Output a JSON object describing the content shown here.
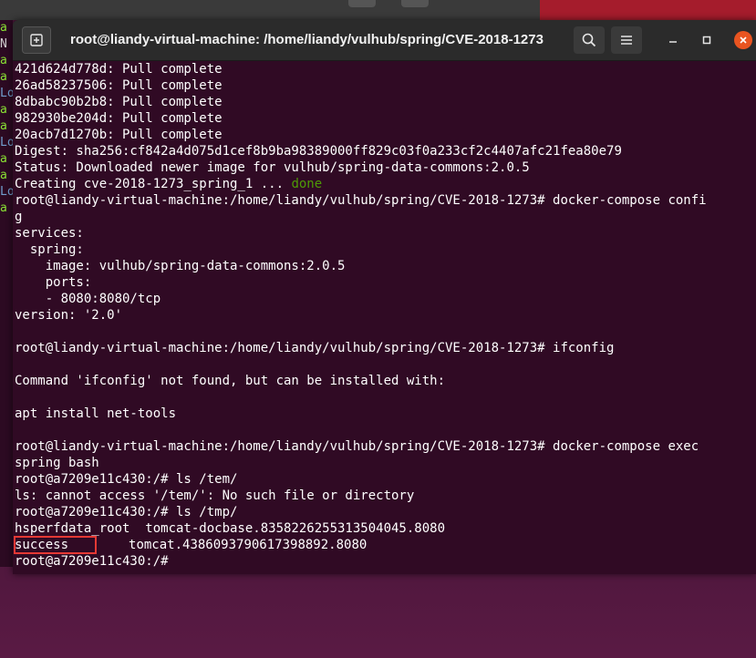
{
  "window": {
    "title": "root@liandy-virtual-machine: /home/liandy/vulhub/spring/CVE-2018-1273"
  },
  "background_terminal": {
    "fragments": [
      "a",
      "N",
      "a",
      "a",
      "Lo",
      "a",
      "a",
      "Lo",
      "a",
      "a",
      "Lo",
      "a"
    ]
  },
  "terminal": {
    "lines": [
      "421d624d778d: Pull complete",
      "26ad58237506: Pull complete",
      "8dbabc90b2b8: Pull complete",
      "982930be204d: Pull complete",
      "20acb7d1270b: Pull complete",
      "Digest: sha256:cf842a4d075d1cef8b9ba98389000ff829c03f0a233cf2c4407afc21fea80e79",
      "Status: Downloaded newer image for vulhub/spring-data-commons:2.0.5",
      "",
      "root@liandy-virtual-machine:/home/liandy/vulhub/spring/CVE-2018-1273# docker-compose confi",
      "g",
      "services:",
      "  spring:",
      "    image: vulhub/spring-data-commons:2.0.5",
      "    ports:",
      "    - 8080:8080/tcp",
      "version: '2.0'",
      "",
      "root@liandy-virtual-machine:/home/liandy/vulhub/spring/CVE-2018-1273# ifconfig",
      "",
      "Command 'ifconfig' not found, but can be installed with:",
      "",
      "apt install net-tools",
      "",
      "root@liandy-virtual-machine:/home/liandy/vulhub/spring/CVE-2018-1273# docker-compose exec",
      "spring bash",
      "root@a7209e11c430:/# ls /tem/",
      "ls: cannot access '/tem/': No such file or directory",
      "root@a7209e11c430:/# ls /tmp/",
      "hsperfdata_root  tomcat-docbase.8358226255313504045.8080",
      "",
      "root@a7209e11c430:/#"
    ],
    "creating_prefix": "Creating cve-2018-1273_spring_1 ... ",
    "creating_status": "done",
    "highlighted_file": "success",
    "tmp_line_2_rest": "tomcat.4386093790617398892.8080"
  },
  "colors": {
    "terminal_bg": "#300a24",
    "status_green": "#4e9a06",
    "highlight_box": "#e53935",
    "close_button": "#e95420"
  },
  "icons": {
    "new_tab": "new-tab-icon",
    "search": "search-icon",
    "menu": "hamburger-menu-icon",
    "minimize": "minimize-icon",
    "maximize": "maximize-icon",
    "close": "close-icon"
  }
}
